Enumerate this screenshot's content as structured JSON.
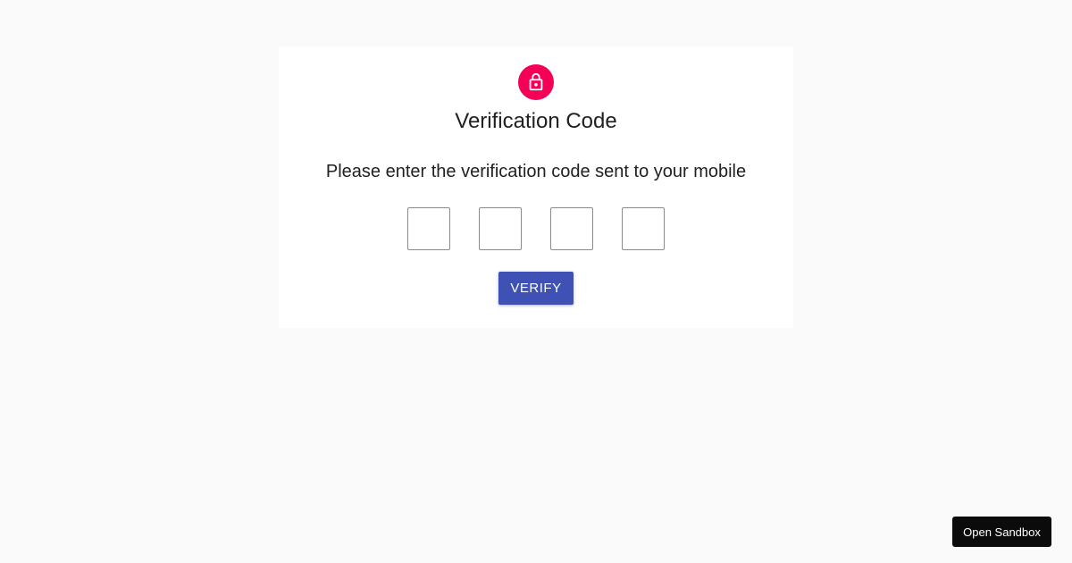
{
  "card": {
    "title": "Verification Code",
    "subtitle": "Please enter the verification code sent to your mobile",
    "icon": "lock-icon",
    "code_inputs": [
      {
        "value": ""
      },
      {
        "value": ""
      },
      {
        "value": ""
      },
      {
        "value": ""
      }
    ],
    "verify_label": "VERIFY"
  },
  "sandbox": {
    "label": "Open Sandbox"
  },
  "colors": {
    "avatar": "#f50057",
    "primary_button": "#3f51b5",
    "background": "#fafafa",
    "sandbox_button": "#0b0b0b"
  }
}
